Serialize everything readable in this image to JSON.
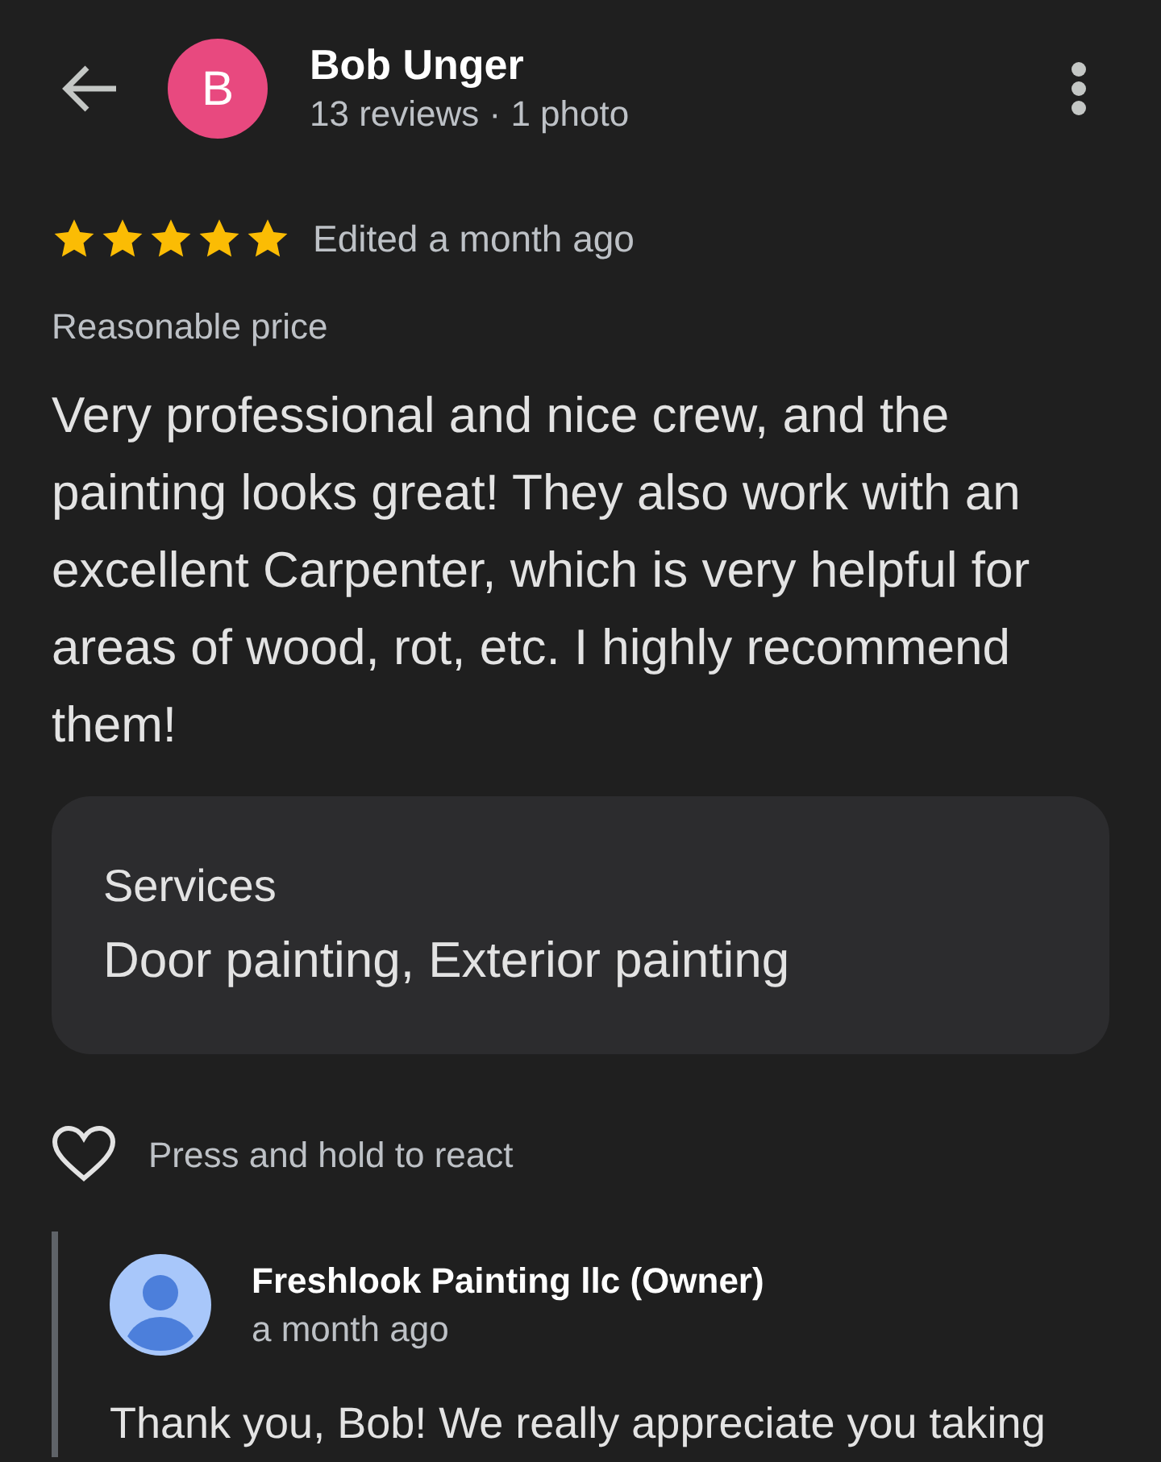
{
  "header": {
    "avatar_letter": "B",
    "name": "Bob Unger",
    "subtitle": "13 reviews · 1 photo"
  },
  "review": {
    "stars": 5,
    "edited": "Edited a month ago",
    "tag": "Reasonable price",
    "text": "Very professional and nice crew, and the painting looks great! They also work with an excellent Carpenter, which is very helpful for areas of wood, rot, etc. I highly recommend them!",
    "services": {
      "label": "Services",
      "value": "Door painting, Exterior painting"
    },
    "react_label": "Press and hold to react"
  },
  "reply": {
    "name": "Freshlook Painting llc (Owner)",
    "time": "a month ago",
    "text": "Thank you, Bob! We really appreciate you taking"
  }
}
